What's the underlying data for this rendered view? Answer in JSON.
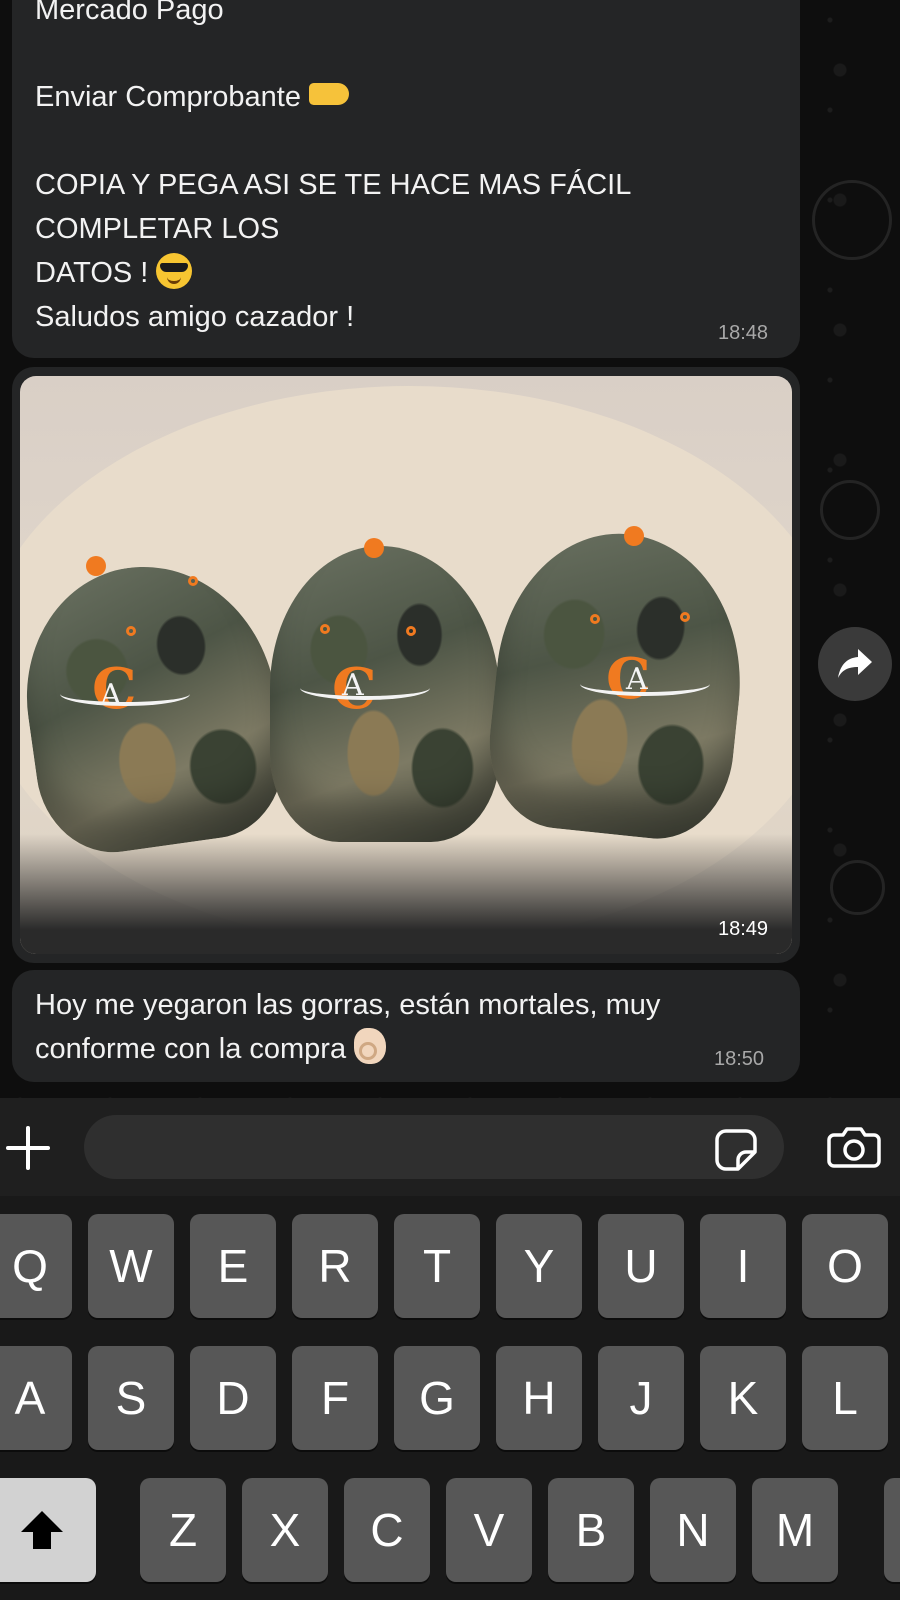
{
  "chat": {
    "message_1": {
      "lines": [
        "Mercado Pago",
        "Enviar Comprobante",
        "COPIA Y PEGA ASI SE TE HACE MAS FÁCIL",
        "COMPLETAR LOS",
        "DATOS  !",
        "Saludos amigo cazador !"
      ],
      "time": "18:48"
    },
    "message_2": {
      "type": "image",
      "time": "18:49"
    },
    "message_3": {
      "lines": [
        "Hoy me yegaron las gorras, están mortales, muy",
        "conforme con la compra"
      ],
      "time": "18:50"
    }
  },
  "icons": {
    "forward": "forward-arrow-icon",
    "plus": "plus-icon",
    "sticker": "sticker-icon",
    "camera": "camera-icon",
    "shift": "shift-icon"
  },
  "input": {
    "value": "",
    "placeholder": ""
  },
  "keyboard": {
    "row1": [
      "Q",
      "W",
      "E",
      "R",
      "T",
      "Y",
      "U",
      "I",
      "O"
    ],
    "row2": [
      "A",
      "S",
      "D",
      "F",
      "G",
      "H",
      "J",
      "K",
      "L"
    ],
    "row3": [
      "Z",
      "X",
      "C",
      "V",
      "B",
      "N",
      "M"
    ]
  },
  "colors": {
    "bubble": "#242526",
    "accent_orange": "#f07a20",
    "background": "#0e0e0e"
  }
}
